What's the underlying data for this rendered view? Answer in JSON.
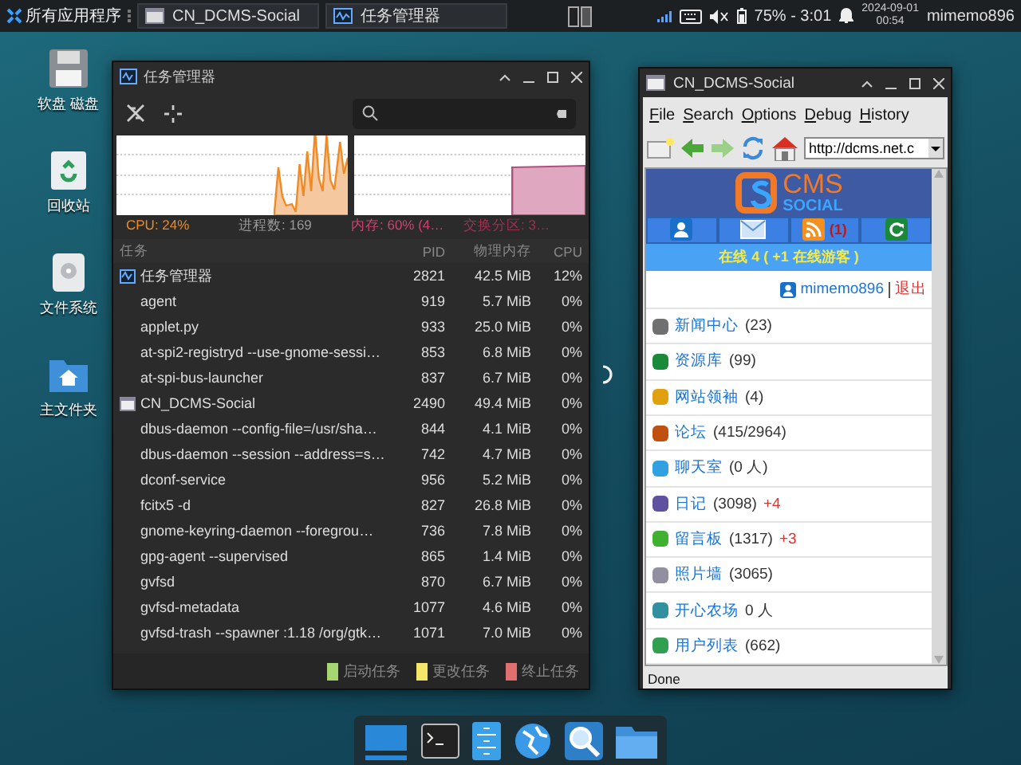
{
  "taskbar": {
    "apps_menu": "所有应用程序",
    "tasks": [
      {
        "title": "CN_DCMS-Social",
        "selected": false
      },
      {
        "title": "任务管理器",
        "selected": false
      }
    ],
    "battery": "75% - 3:01",
    "date": "2024-09-01",
    "time": "00:54",
    "user": "mimemo896"
  },
  "desktop_icons": [
    {
      "kind": "floppy",
      "label": "软盘 磁盘"
    },
    {
      "kind": "trash",
      "label": "回收站"
    },
    {
      "kind": "drive",
      "label": "文件系统"
    },
    {
      "kind": "home",
      "label": "主文件夹"
    }
  ],
  "task_manager": {
    "title": "任务管理器",
    "stats": {
      "cpu": "CPU: 24%",
      "processes": "进程数: 169",
      "memory": "内存: 60% (4…",
      "swap": "交换分区: 3…"
    },
    "columns": [
      "任务",
      "PID",
      "物理内存",
      "CPU"
    ],
    "rows": [
      {
        "kind": "window",
        "name": "任务管理器",
        "pid": "2821",
        "memory": "42.5 MiB",
        "cpu": "12%"
      },
      {
        "kind": "process",
        "name": "agent",
        "pid": "919",
        "memory": "5.7 MiB",
        "cpu": "0%"
      },
      {
        "kind": "process",
        "name": "applet.py",
        "pid": "933",
        "memory": "25.0 MiB",
        "cpu": "0%"
      },
      {
        "kind": "process",
        "name": "at-spi2-registryd --use-gnome-sessi…",
        "pid": "853",
        "memory": "6.8 MiB",
        "cpu": "0%"
      },
      {
        "kind": "process",
        "name": "at-spi-bus-launcher",
        "pid": "837",
        "memory": "6.7 MiB",
        "cpu": "0%"
      },
      {
        "kind": "browser",
        "name": "CN_DCMS-Social",
        "pid": "2490",
        "memory": "49.4 MiB",
        "cpu": "0%"
      },
      {
        "kind": "process",
        "name": "dbus-daemon --config-file=/usr/sha…",
        "pid": "844",
        "memory": "4.1 MiB",
        "cpu": "0%"
      },
      {
        "kind": "process",
        "name": "dbus-daemon --session --address=s…",
        "pid": "742",
        "memory": "4.7 MiB",
        "cpu": "0%"
      },
      {
        "kind": "process",
        "name": "dconf-service",
        "pid": "956",
        "memory": "5.2 MiB",
        "cpu": "0%"
      },
      {
        "kind": "process",
        "name": "fcitx5 -d",
        "pid": "827",
        "memory": "26.8 MiB",
        "cpu": "0%"
      },
      {
        "kind": "process",
        "name": "gnome-keyring-daemon --foregrou…",
        "pid": "736",
        "memory": "7.8 MiB",
        "cpu": "0%"
      },
      {
        "kind": "process",
        "name": "gpg-agent --supervised",
        "pid": "865",
        "memory": "1.4 MiB",
        "cpu": "0%"
      },
      {
        "kind": "process",
        "name": "gvfsd",
        "pid": "870",
        "memory": "6.7 MiB",
        "cpu": "0%"
      },
      {
        "kind": "process",
        "name": "gvfsd-metadata",
        "pid": "1077",
        "memory": "4.6 MiB",
        "cpu": "0%"
      },
      {
        "kind": "process",
        "name": "gvfsd-trash --spawner :1.18 /org/gtk…",
        "pid": "1071",
        "memory": "7.0 MiB",
        "cpu": "0%"
      }
    ],
    "legend": [
      {
        "label": "启动任务",
        "color": "#a6d672"
      },
      {
        "label": "更改任务",
        "color": "#f5e66a"
      },
      {
        "label": "终止任务",
        "color": "#e07070"
      }
    ]
  },
  "browser": {
    "title": "CN_DCMS-Social",
    "menu": [
      "File",
      "Search",
      "Options",
      "Debug",
      "History"
    ],
    "url": "http://dcms.net.c",
    "logo": {
      "top": "CMS",
      "bottom": "SOCIAL"
    },
    "nav": [
      {
        "kind": "profile"
      },
      {
        "kind": "mail"
      },
      {
        "kind": "rss",
        "badge": "(1)"
      },
      {
        "kind": "refresh"
      }
    ],
    "online": "在线 4 ( +1 在线游客 )",
    "user": "mimemo896",
    "logout": "退出",
    "items": [
      {
        "name": "新闻中心",
        "count": "(23)",
        "color": "#707070"
      },
      {
        "name": "资源库",
        "count": "(99)",
        "color": "#1a8a3a"
      },
      {
        "name": "网站领袖",
        "count": "(4)",
        "color": "#e0a010"
      },
      {
        "name": "论坛",
        "count": "(415/2964)",
        "color": "#c05010"
      },
      {
        "name": "聊天室",
        "count": "(0 人)",
        "color": "#30a0e0"
      },
      {
        "name": "日记",
        "count": "(3098)",
        "new": "+4",
        "color": "#6050a0"
      },
      {
        "name": "留言板",
        "count": "(1317)",
        "new": "+3",
        "color": "#40b030"
      },
      {
        "name": "照片墙",
        "count": "(3065)",
        "color": "#9090a0"
      },
      {
        "name": "开心农场",
        "count": "0 人",
        "color": "#3090a0"
      },
      {
        "name": "用户列表",
        "count": "(662)",
        "color": "#30a050"
      }
    ],
    "status": "Done"
  }
}
